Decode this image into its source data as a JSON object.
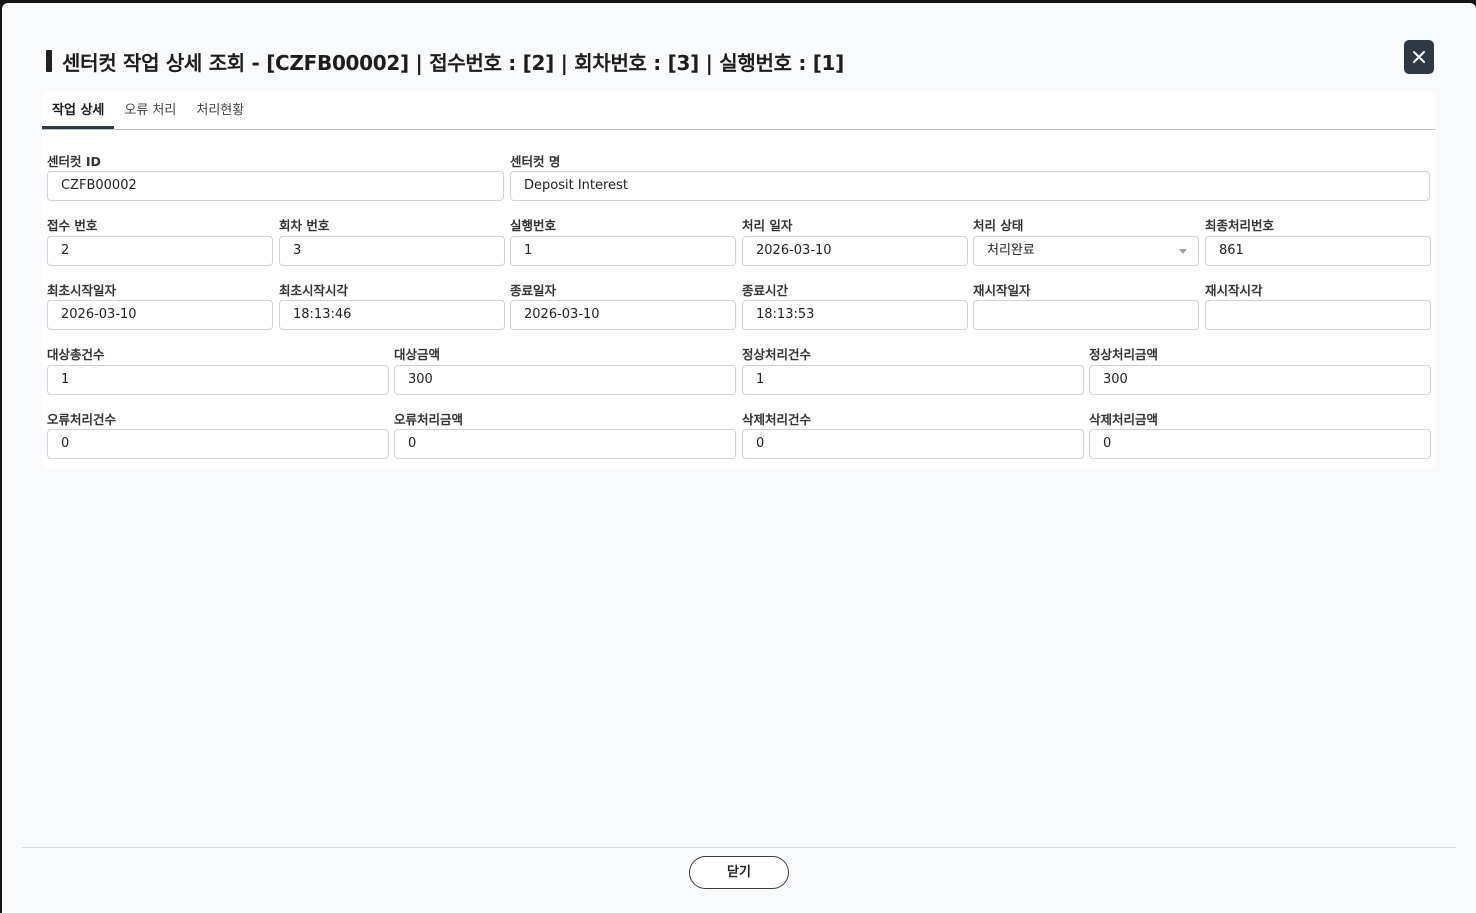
{
  "header": {
    "title": "센터컷 작업 상세 조회 - [CZFB00002] | 접수번호 : [2] | 회차번호 : [3] | 실행번호 : [1]",
    "close_icon": "close-icon"
  },
  "tabs": [
    {
      "label": "작업 상세",
      "active": true
    },
    {
      "label": "오류 처리",
      "active": false
    },
    {
      "label": "처리현황",
      "active": false
    }
  ],
  "form": {
    "centercut_id": {
      "label": "센터컷 ID",
      "value": "CZFB00002"
    },
    "centercut_name": {
      "label": "센터컷 명",
      "value": "Deposit Interest"
    },
    "receipt_no": {
      "label": "접수 번호",
      "value": "2"
    },
    "round_no": {
      "label": "회차 번호",
      "value": "3"
    },
    "exec_no": {
      "label": "실행번호",
      "value": "1"
    },
    "process_date": {
      "label": "처리 일자",
      "value": "2026-03-10"
    },
    "process_status": {
      "label": "처리 상태",
      "value": "처리완료"
    },
    "final_process_no": {
      "label": "최종처리번호",
      "value": "861"
    },
    "first_start_date": {
      "label": "최초시작일자",
      "value": "2026-03-10"
    },
    "first_start_time": {
      "label": "최초시작시각",
      "value": "18:13:46"
    },
    "end_date": {
      "label": "종료일자",
      "value": "2026-03-10"
    },
    "end_time": {
      "label": "종료시간",
      "value": "18:13:53"
    },
    "restart_date": {
      "label": "재시작일자",
      "value": ""
    },
    "restart_time": {
      "label": "재시작시각",
      "value": ""
    },
    "target_total_count": {
      "label": "대상총건수",
      "value": "1"
    },
    "target_amount": {
      "label": "대상금액",
      "value": "300"
    },
    "normal_count": {
      "label": "정상처리건수",
      "value": "1"
    },
    "normal_amount": {
      "label": "정상처리금액",
      "value": "300"
    },
    "error_count": {
      "label": "오류처리건수",
      "value": "0"
    },
    "error_amount": {
      "label": "오류처리금액",
      "value": "0"
    },
    "delete_count": {
      "label": "삭제처리건수",
      "value": "0"
    },
    "delete_amount": {
      "label": "삭제처리금액",
      "value": "0"
    }
  },
  "footer": {
    "close_label": "닫기"
  }
}
